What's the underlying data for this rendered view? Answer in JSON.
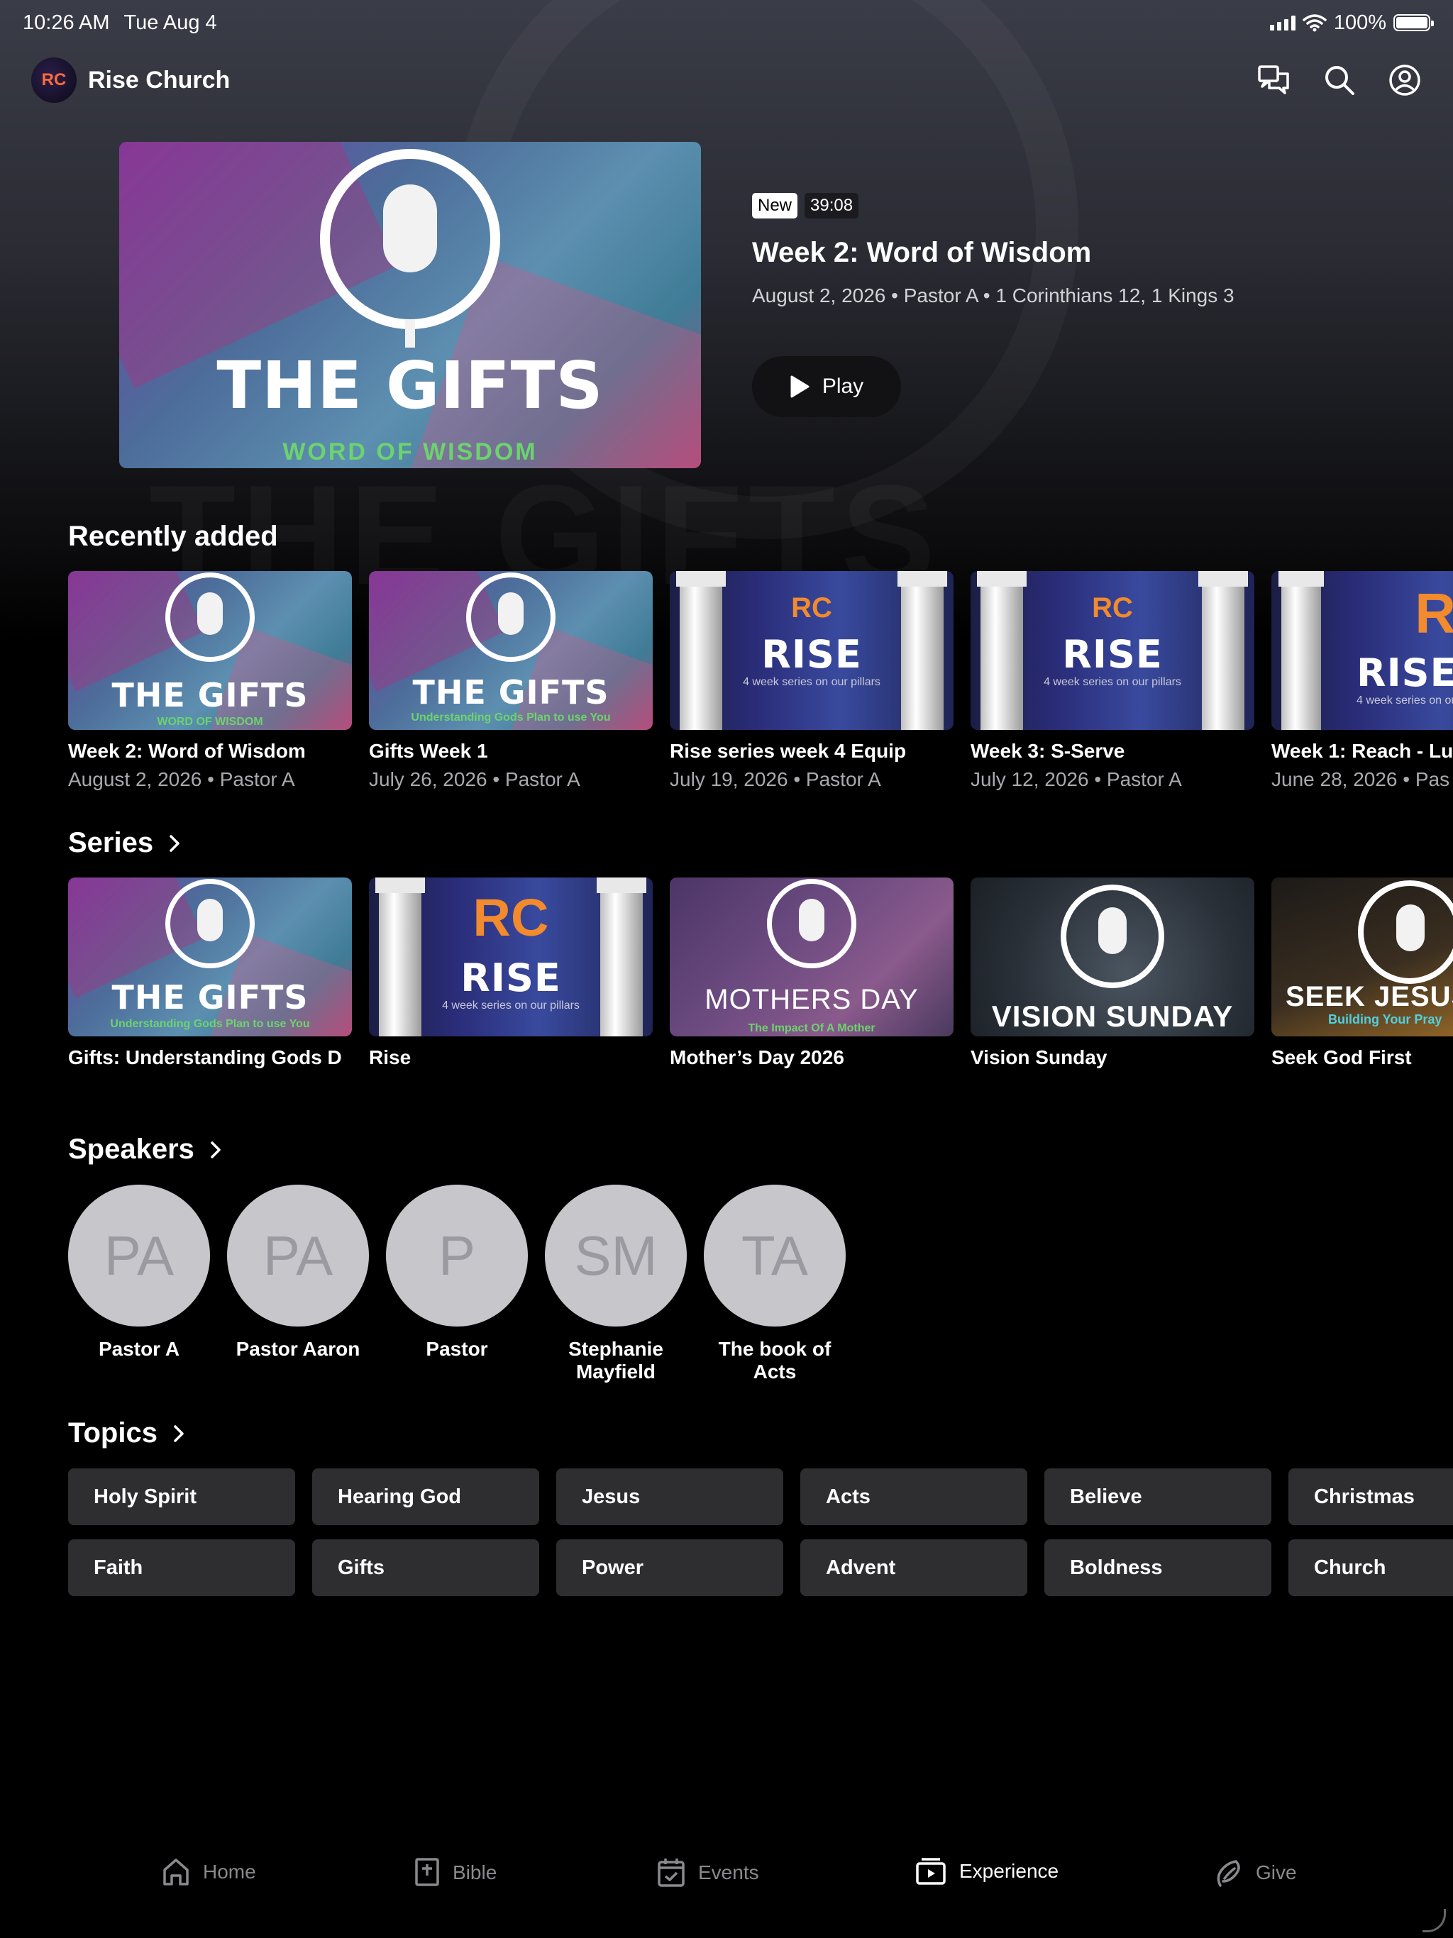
{
  "status": {
    "time": "10:26 AM",
    "date": "Tue Aug 4",
    "battery": "100%"
  },
  "app": {
    "title": "Rise Church",
    "logo_text": "RC"
  },
  "featured": {
    "badge": "New",
    "duration": "39:08",
    "title": "Week 2: Word of Wisdom",
    "meta": "August 2, 2026 • Pastor A • 1 Corinthians 12, 1 Kings 3",
    "play_label": "Play",
    "art_title": "THE GIFTS",
    "art_subtitle": "WORD OF WISDOM"
  },
  "recent": {
    "title": "Recently added",
    "items": [
      {
        "title": "Week 2: Word of Wisdom",
        "sub": "August 2, 2026 • Pastor A",
        "art_big": "THE GIFTS",
        "art_sub": "WORD OF WISDOM"
      },
      {
        "title": "Gifts Week 1",
        "sub": "July 26, 2026 • Pastor A",
        "art_big": "THE GIFTS",
        "art_sub": "Understanding Gods Plan to use You"
      },
      {
        "title": "Rise series week 4 Equip",
        "sub": "July 19, 2026 • Pastor A",
        "art_big": "RISE",
        "art_sub": "4 week series on our pillars"
      },
      {
        "title": "Week 3: S-Serve",
        "sub": "July 12, 2026 • Pastor A",
        "art_big": "RISE",
        "art_sub": "4 week series on our pillars"
      },
      {
        "title": "Week 1: Reach - Lu",
        "sub": "June 28, 2026 • Pas",
        "art_big": "RISE",
        "art_sub": "4 week series on our"
      }
    ]
  },
  "series": {
    "title": "Series",
    "items": [
      {
        "title": "Gifts: Understanding Gods D",
        "art_big": "THE GIFTS",
        "art_sub": "Understanding Gods Plan to use You"
      },
      {
        "title": "Rise",
        "art_big": "RISE",
        "art_sub": "4 week series on our pillars"
      },
      {
        "title": "Mother’s Day 2026",
        "art_big": "MOTHERS DAY",
        "art_sub": "The Impact Of A Mother"
      },
      {
        "title": "Vision Sunday",
        "art_big": "VISION SUNDAY",
        "art_sub": ""
      },
      {
        "title": "Seek God First",
        "art_big": "SEEK JESUS",
        "art_sub": "Building Your Pray"
      }
    ]
  },
  "speakers": {
    "title": "Speakers",
    "items": [
      {
        "initials": "PA",
        "name": "Pastor A"
      },
      {
        "initials": "PA",
        "name": "Pastor Aaron"
      },
      {
        "initials": "P",
        "name": "Pastor"
      },
      {
        "initials": "SM",
        "name": "Stephanie Mayfield"
      },
      {
        "initials": "TA",
        "name": "The book of Acts"
      }
    ]
  },
  "topics": {
    "title": "Topics",
    "items": [
      "Holy Spirit",
      "Hearing God",
      "Jesus",
      "Acts",
      "Believe",
      "Christmas",
      "Faith",
      "Gifts",
      "Power",
      "Advent",
      "Boldness",
      "Church"
    ]
  },
  "tabs": [
    {
      "label": "Home",
      "icon": "home-icon"
    },
    {
      "label": "Bible",
      "icon": "bible-icon"
    },
    {
      "label": "Events",
      "icon": "calendar-icon"
    },
    {
      "label": "Experience",
      "icon": "media-icon",
      "active": true
    },
    {
      "label": "Give",
      "icon": "give-icon"
    }
  ],
  "colors": {
    "background": "#000000",
    "topic_chip": "#2e2e31",
    "avatar": "#c6c6cb",
    "inactive_tab": "#8a8a8e"
  }
}
